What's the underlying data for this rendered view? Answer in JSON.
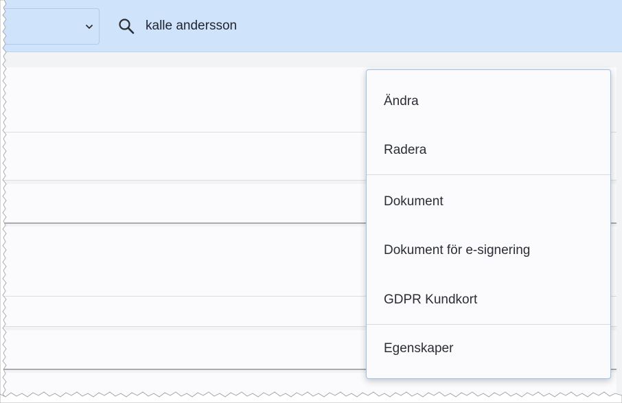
{
  "toolbar": {
    "select_value": "",
    "search_value": "kalle andersson",
    "select_icon": "chevron-down-icon",
    "search_icon": "search-icon",
    "background_color": "#cfe3fb"
  },
  "context_menu": {
    "items": [
      {
        "label": "Ändra",
        "group": 1
      },
      {
        "label": "Radera",
        "group": 1
      },
      {
        "label": "Dokument",
        "group": 2
      },
      {
        "label": "Dokument för e-signering",
        "group": 2
      },
      {
        "label": "GDPR Kundkort",
        "group": 2
      },
      {
        "label": "Egenskaper",
        "group": 3
      }
    ],
    "border_color": "#9cc2ec"
  }
}
